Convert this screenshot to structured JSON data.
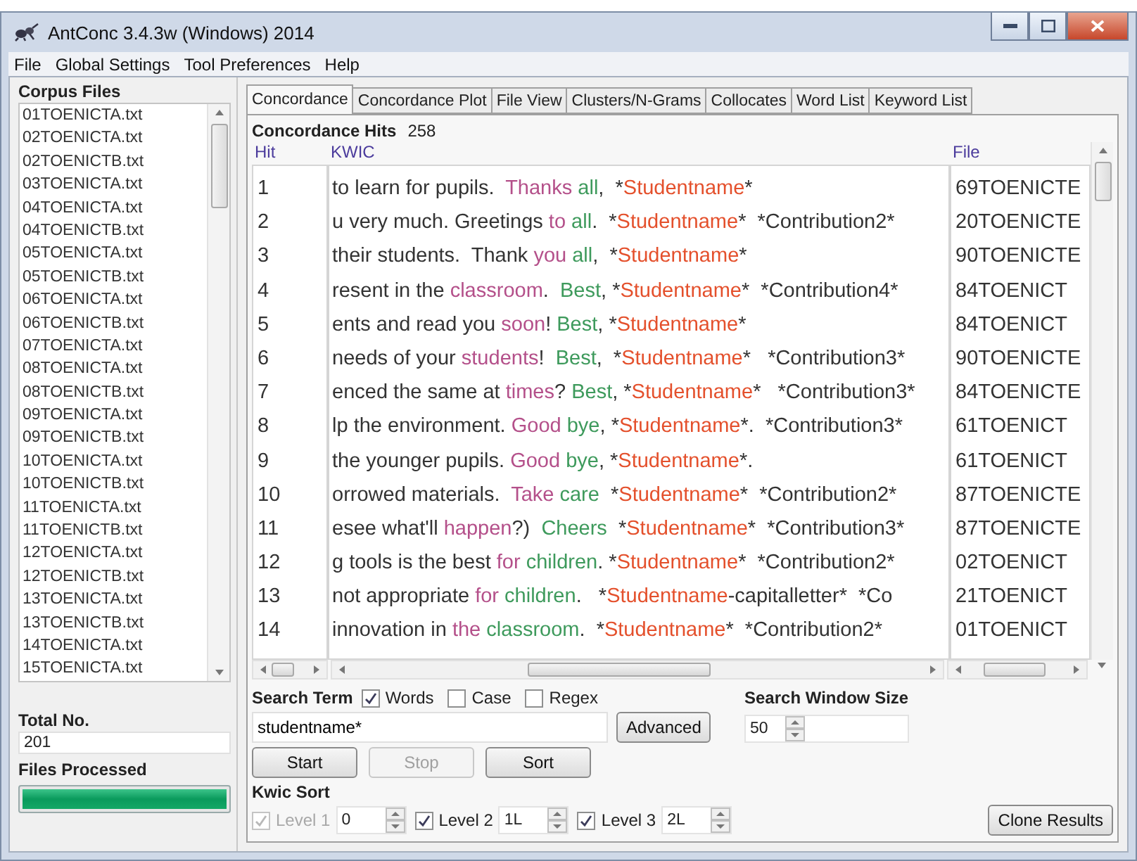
{
  "window": {
    "title": "AntConc 3.4.3w (Windows) 2014"
  },
  "menu": [
    "File",
    "Global Settings",
    "Tool Preferences",
    "Help"
  ],
  "corpus": {
    "heading": "Corpus Files",
    "files": [
      "01TOENICTA.txt",
      "02TOENICTA.txt",
      "02TOENICTB.txt",
      "03TOENICTA.txt",
      "04TOENICTA.txt",
      "04TOENICTB.txt",
      "05TOENICTA.txt",
      "05TOENICTB.txt",
      "06TOENICTA.txt",
      "06TOENICTB.txt",
      "07TOENICTA.txt",
      "08TOENICTA.txt",
      "08TOENICTB.txt",
      "09TOENICTA.txt",
      "09TOENICTB.txt",
      "10TOENICTA.txt",
      "10TOENICTB.txt",
      "11TOENICTA.txt",
      "11TOENICTB.txt",
      "12TOENICTA.txt",
      "12TOENICTB.txt",
      "13TOENICTA.txt",
      "13TOENICTB.txt",
      "14TOENICTA.txt",
      "15TOENICTA.txt"
    ],
    "total_label": "Total No.",
    "total": "201",
    "processed_label": "Files Processed",
    "progress": {
      "level": 1
    }
  },
  "tabs": [
    {
      "label": "Concordance",
      "selected": true
    },
    {
      "label": "Concordance Plot",
      "selected": false
    },
    {
      "label": "File View",
      "selected": false
    },
    {
      "label": "Clusters/N-Grams",
      "selected": false
    },
    {
      "label": "Collocates",
      "selected": false
    },
    {
      "label": "Word List",
      "selected": false
    },
    {
      "label": "Keyword List",
      "selected": false
    }
  ],
  "hits": {
    "label": "Concordance Hits",
    "count": "258"
  },
  "table": {
    "columns": [
      "Hit",
      "KWIC",
      "File"
    ],
    "rows": [
      {
        "hit": "1",
        "file": "69TOENICTE",
        "kwic": [
          {
            "kind": "plain",
            "text": "to learn for pupils.  "
          },
          {
            "kind": "left",
            "text": "Thanks"
          },
          {
            "kind": "right",
            "text": " all"
          },
          {
            "kind": "plain",
            "text": ",  *"
          },
          {
            "kind": "hit",
            "text": "Studentname"
          },
          {
            "kind": "plain",
            "text": "*"
          }
        ]
      },
      {
        "hit": "2",
        "file": "20TOENICTE",
        "kwic": [
          {
            "kind": "plain",
            "text": "u very much. Greetings "
          },
          {
            "kind": "left",
            "text": "to"
          },
          {
            "kind": "right",
            "text": " all"
          },
          {
            "kind": "plain",
            "text": ".  *"
          },
          {
            "kind": "hit",
            "text": "Studentname"
          },
          {
            "kind": "plain",
            "text": "*  *Contribution2*"
          }
        ]
      },
      {
        "hit": "3",
        "file": "90TOENICTE",
        "kwic": [
          {
            "kind": "plain",
            "text": "their students.  Thank "
          },
          {
            "kind": "left",
            "text": "you"
          },
          {
            "kind": "right",
            "text": " all"
          },
          {
            "kind": "plain",
            "text": ",  *"
          },
          {
            "kind": "hit",
            "text": "Studentname"
          },
          {
            "kind": "plain",
            "text": "*"
          }
        ]
      },
      {
        "hit": "4",
        "file": "84TOENICT",
        "kwic": [
          {
            "kind": "plain",
            "text": "resent in the "
          },
          {
            "kind": "left",
            "text": "classroom"
          },
          {
            "kind": "plain",
            "text": ".  "
          },
          {
            "kind": "right",
            "text": "Best"
          },
          {
            "kind": "plain",
            "text": ", *"
          },
          {
            "kind": "hit",
            "text": "Studentname"
          },
          {
            "kind": "plain",
            "text": "*  *Contribution4*"
          }
        ]
      },
      {
        "hit": "5",
        "file": "84TOENICT",
        "kwic": [
          {
            "kind": "plain",
            "text": "ents and read you "
          },
          {
            "kind": "left",
            "text": "soon"
          },
          {
            "kind": "plain",
            "text": "! "
          },
          {
            "kind": "right",
            "text": "Best"
          },
          {
            "kind": "plain",
            "text": ", *"
          },
          {
            "kind": "hit",
            "text": "Studentname"
          },
          {
            "kind": "plain",
            "text": "*"
          }
        ]
      },
      {
        "hit": "6",
        "file": "90TOENICTE",
        "kwic": [
          {
            "kind": "plain",
            "text": "needs of your "
          },
          {
            "kind": "left",
            "text": "students"
          },
          {
            "kind": "plain",
            "text": "!  "
          },
          {
            "kind": "right",
            "text": "Best"
          },
          {
            "kind": "plain",
            "text": ",  *"
          },
          {
            "kind": "hit",
            "text": "Studentname"
          },
          {
            "kind": "plain",
            "text": "*   *Contribution3*"
          }
        ]
      },
      {
        "hit": "7",
        "file": "84TOENICTE",
        "kwic": [
          {
            "kind": "plain",
            "text": "enced the same at "
          },
          {
            "kind": "left",
            "text": "times"
          },
          {
            "kind": "plain",
            "text": "? "
          },
          {
            "kind": "right",
            "text": "Best"
          },
          {
            "kind": "plain",
            "text": ", *"
          },
          {
            "kind": "hit",
            "text": "Studentname"
          },
          {
            "kind": "plain",
            "text": "*   *Contribution3*"
          }
        ]
      },
      {
        "hit": "8",
        "file": "61TOENICT",
        "kwic": [
          {
            "kind": "plain",
            "text": "lp the environment. "
          },
          {
            "kind": "left",
            "text": "Good"
          },
          {
            "kind": "right",
            "text": " bye"
          },
          {
            "kind": "plain",
            "text": ", *"
          },
          {
            "kind": "hit",
            "text": "Studentname"
          },
          {
            "kind": "plain",
            "text": "*.  *Contribution3*"
          }
        ]
      },
      {
        "hit": "9",
        "file": "61TOENICT",
        "kwic": [
          {
            "kind": "plain",
            "text": "the younger pupils. "
          },
          {
            "kind": "left",
            "text": "Good"
          },
          {
            "kind": "right",
            "text": " bye"
          },
          {
            "kind": "plain",
            "text": ", *"
          },
          {
            "kind": "hit",
            "text": "Studentname"
          },
          {
            "kind": "plain",
            "text": "*."
          }
        ]
      },
      {
        "hit": "10",
        "file": "87TOENICTE",
        "kwic": [
          {
            "kind": "plain",
            "text": "orrowed materials.  "
          },
          {
            "kind": "left",
            "text": "Take"
          },
          {
            "kind": "right",
            "text": " care"
          },
          {
            "kind": "plain",
            "text": "  *"
          },
          {
            "kind": "hit",
            "text": "Studentname"
          },
          {
            "kind": "plain",
            "text": "*  *Contribution2*"
          }
        ]
      },
      {
        "hit": "11",
        "file": "87TOENICTE",
        "kwic": [
          {
            "kind": "plain",
            "text": "esee what'll "
          },
          {
            "kind": "left",
            "text": "happen"
          },
          {
            "kind": "plain",
            "text": "?)  "
          },
          {
            "kind": "right",
            "text": "Cheers"
          },
          {
            "kind": "plain",
            "text": "  *"
          },
          {
            "kind": "hit",
            "text": "Studentname"
          },
          {
            "kind": "plain",
            "text": "*  *Contribution3*"
          }
        ]
      },
      {
        "hit": "12",
        "file": "02TOENICT",
        "kwic": [
          {
            "kind": "plain",
            "text": "g tools is the best "
          },
          {
            "kind": "left",
            "text": "for"
          },
          {
            "kind": "right",
            "text": " children"
          },
          {
            "kind": "plain",
            "text": ". *"
          },
          {
            "kind": "hit",
            "text": "Studentname"
          },
          {
            "kind": "plain",
            "text": "*  *Contribution2*"
          }
        ]
      },
      {
        "hit": "13",
        "file": "21TOENICT",
        "kwic": [
          {
            "kind": "plain",
            "text": "not appropriate "
          },
          {
            "kind": "left",
            "text": "for"
          },
          {
            "kind": "right",
            "text": " children"
          },
          {
            "kind": "plain",
            "text": ".   *"
          },
          {
            "kind": "hit",
            "text": "Studentname"
          },
          {
            "kind": "plain",
            "text": "-capitalletter*  *Co"
          }
        ]
      },
      {
        "hit": "14",
        "file": "01TOENICT",
        "kwic": [
          {
            "kind": "plain",
            "text": "innovation in "
          },
          {
            "kind": "left",
            "text": "the"
          },
          {
            "kind": "right",
            "text": " classroom"
          },
          {
            "kind": "plain",
            "text": ".  *"
          },
          {
            "kind": "hit",
            "text": "Studentname"
          },
          {
            "kind": "plain",
            "text": "*  *Contribution2*"
          }
        ]
      }
    ]
  },
  "search": {
    "label": "Search Term",
    "options": [
      {
        "label": "Words",
        "checked": true
      },
      {
        "label": "Case",
        "checked": false
      },
      {
        "label": "Regex",
        "checked": false
      }
    ],
    "value": "studentname*",
    "advanced": "Advanced",
    "window_size_label": "Search Window Size",
    "window_size": "50"
  },
  "actions": [
    {
      "label": "Start",
      "disabled": false
    },
    {
      "label": "Stop",
      "disabled": true
    },
    {
      "label": "Sort",
      "disabled": false
    }
  ],
  "kwic_sort": {
    "label": "Kwic Sort",
    "levels": [
      {
        "label": "Level 1",
        "checked": true,
        "disabled": true,
        "value": "0"
      },
      {
        "label": "Level 2",
        "checked": true,
        "disabled": false,
        "value": "1L"
      },
      {
        "label": "Level 3",
        "checked": true,
        "disabled": false,
        "value": "2L"
      }
    ]
  },
  "clone": "Clone Results"
}
